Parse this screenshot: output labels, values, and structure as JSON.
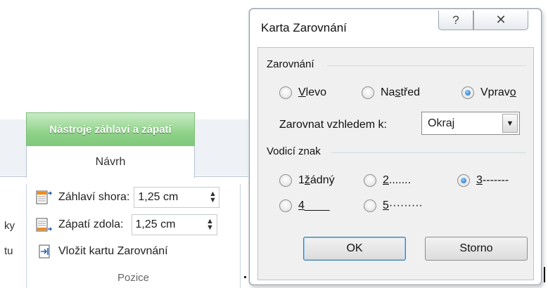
{
  "ribbon": {
    "contextual_tab": "Nástroje záhlaví a zápatí",
    "active_tab": "Návrh",
    "cut_labels": [
      "ky",
      "tu"
    ],
    "header_top_label": "Záhlaví shora:",
    "header_top_value": "1,25 cm",
    "footer_bottom_label": "Zápatí zdola:",
    "footer_bottom_value": "1,25 cm",
    "insert_tab_label": "Vložit kartu Zarovnání",
    "group_label": "Pozice",
    "spinner_up": "▲",
    "spinner_down": "▼"
  },
  "dialog": {
    "title": "Karta Zarovnání",
    "help_glyph": "?",
    "close_glyph": "✕",
    "alignment": {
      "heading": "Zarovnání",
      "options": [
        {
          "pre": "",
          "key": "V",
          "post": "levo",
          "checked": false
        },
        {
          "pre": "Na ",
          "key": "s",
          "post": "třed",
          "checked": false
        },
        {
          "pre": "Vprav",
          "key": "o",
          "post": "",
          "checked": true
        }
      ],
      "relative_label": "Zarovnat vzhledem k:",
      "relative_value": "Okraj",
      "dropdown_glyph": "▼"
    },
    "leader": {
      "heading": "Vodicí znak",
      "options": [
        {
          "pre": "1 ",
          "key": "ž",
          "post": "ádný",
          "checked": false
        },
        {
          "pre": "",
          "key": "2",
          "post": " .......",
          "checked": false
        },
        {
          "pre": "",
          "key": "3",
          "post": " -------",
          "checked": true
        },
        {
          "pre": "",
          "key": "4",
          "post": " ____",
          "checked": false
        },
        {
          "pre": "",
          "key": "5",
          "post": " ·········",
          "checked": false
        }
      ]
    },
    "ok_label": "OK",
    "cancel_label": "Storno"
  },
  "colors": {
    "contextual_tab": "#8fd289",
    "radio_selected": "#1f5fb5",
    "dialog_panel": "#f0f0f0"
  },
  "icons": [
    "header-position-icon",
    "footer-position-icon",
    "insert-alignment-tab-icon",
    "help-icon",
    "close-icon",
    "radio-icon"
  ]
}
